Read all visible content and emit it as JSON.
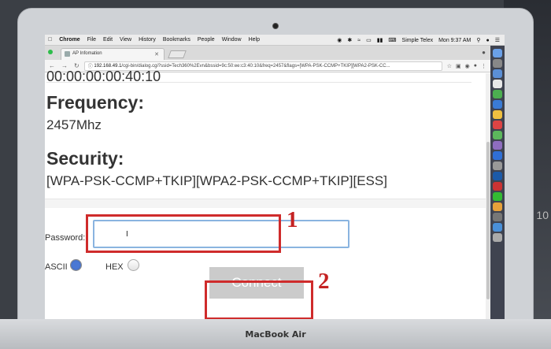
{
  "menubar": {
    "items": [
      "Chrome",
      "File",
      "Edit",
      "View",
      "History",
      "Bookmarks",
      "People",
      "Window",
      "Help"
    ],
    "right_app": "Simple Telex",
    "clock": "Mon 9:37 AM"
  },
  "browser": {
    "tab_title": "AP Infomation",
    "url_host": "192.168.49.1",
    "url_path": "/cgi-bin/dialog.cgi?ssid=Tech360%2Evn&bssid=9c:50:ee:c3:40:10&freq=2457&flags=[WPA-PSK-CCMP+TKIP][WPA2-PSK-CC..."
  },
  "page": {
    "mac_fragment": "00:00:00:00:40:10",
    "frequency_heading": "Frequency:",
    "frequency_value": "2457Mhz",
    "security_heading": "Security:",
    "security_value": "[WPA-PSK-CCMP+TKIP][WPA2-PSK-CCMP+TKIP][ESS]",
    "password_label": "Password:",
    "password_value": "I",
    "ascii_label": "ASCII",
    "hex_label": "HEX",
    "connect_label": "Connect"
  },
  "annotations": {
    "step1": "1",
    "step2": "2",
    "color": "#cf2b2b"
  },
  "laptop": {
    "label": "MacBook Air"
  },
  "side_text": "10"
}
